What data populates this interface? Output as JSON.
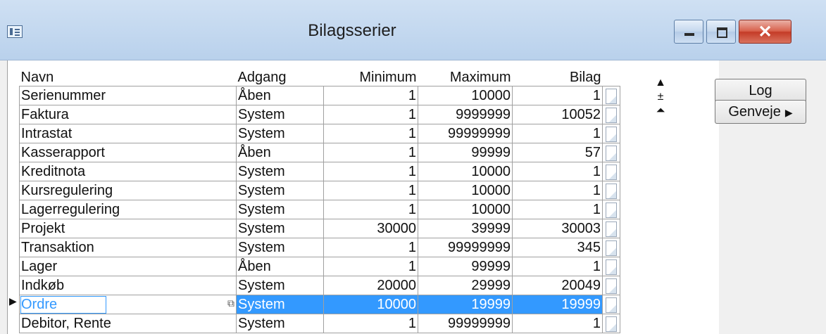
{
  "window": {
    "title": "Bilagsserier"
  },
  "columns": [
    "Navn",
    "Adgang",
    "Minimum",
    "Maximum",
    "Bilag"
  ],
  "rows": [
    [
      "Serienummer",
      "Åben",
      "1",
      "10000",
      "1"
    ],
    [
      "Faktura",
      "System",
      "1",
      "9999999",
      "10052"
    ],
    [
      "Intrastat",
      "System",
      "1",
      "99999999",
      "1"
    ],
    [
      "Kasserapport",
      "Åben",
      "1",
      "99999",
      "57"
    ],
    [
      "Kreditnota",
      "System",
      "1",
      "10000",
      "1"
    ],
    [
      "Kursregulering",
      "System",
      "1",
      "10000",
      "1"
    ],
    [
      "Lagerregulering",
      "System",
      "1",
      "10000",
      "1"
    ],
    [
      "Projekt",
      "System",
      "30000",
      "39999",
      "30003"
    ],
    [
      "Transaktion",
      "System",
      "1",
      "99999999",
      "345"
    ],
    [
      "Lager",
      "Åben",
      "1",
      "99999",
      "1"
    ],
    [
      "Indkøb",
      "System",
      "20000",
      "29999",
      "20049"
    ],
    [
      "Ordre",
      "System",
      "10000",
      "19999",
      "19999"
    ],
    [
      "Debitor, Rente",
      "System",
      "1",
      "99999999",
      "1"
    ]
  ],
  "selected_row_index": 11,
  "buttons": {
    "log": "Log",
    "genveje": "Genveje"
  }
}
